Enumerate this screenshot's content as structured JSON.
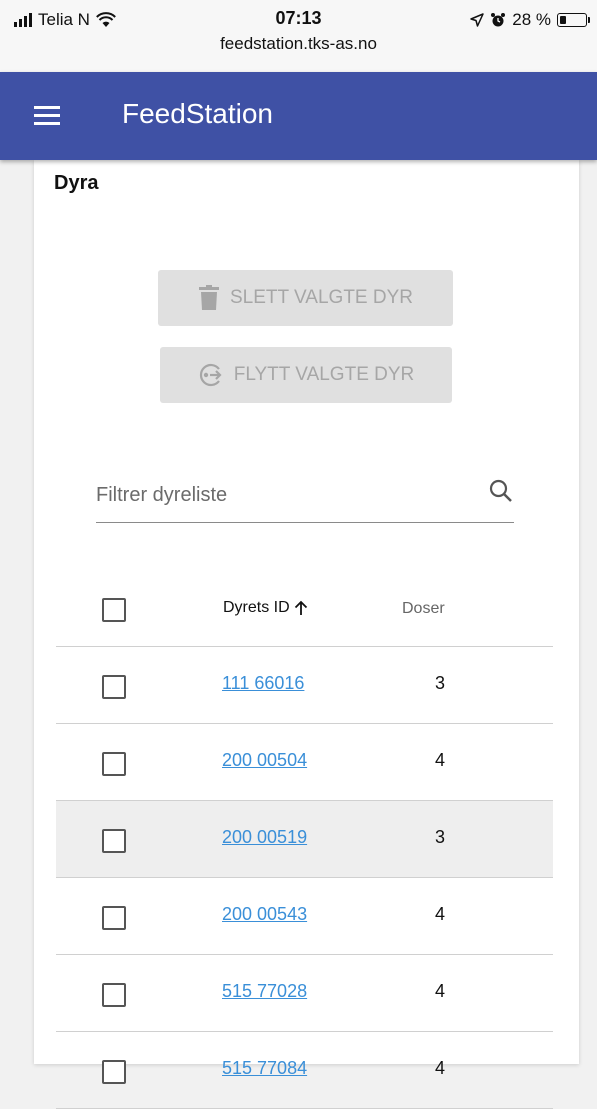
{
  "status_bar": {
    "carrier": "Telia N",
    "time": "07:13",
    "url": "feedstation.tks-as.no",
    "battery": "28 %",
    "battery_level": 0.28
  },
  "app_bar": {
    "title": "FeedStation",
    "menu_icon": "menu-icon"
  },
  "card": {
    "title": "Dyra",
    "delete_button": {
      "label": "SLETT VALGTE DYR",
      "icon": "trash-icon"
    },
    "move_button": {
      "label": "FLYTT VALGTE DYR",
      "icon": "move-icon"
    },
    "filter": {
      "placeholder": "Filtrer dyreliste",
      "value": "",
      "icon": "search-icon"
    }
  },
  "table": {
    "headers": {
      "id": "Dyrets ID",
      "sort_icon": "arrow-up-icon",
      "doses": "Doser"
    },
    "rows": [
      {
        "id": "111 66016",
        "doses": "3"
      },
      {
        "id": "200 00504",
        "doses": "4"
      },
      {
        "id": "200 00519",
        "doses": "3"
      },
      {
        "id": "200 00543",
        "doses": "4"
      },
      {
        "id": "515 77028",
        "doses": "4"
      },
      {
        "id": "515 77084",
        "doses": "4"
      }
    ]
  },
  "colors": {
    "app_bar": "#3f51a5",
    "link": "#3a8fd8",
    "disabled_button": "#e0e0e0",
    "disabled_text": "#a6a6a6"
  }
}
